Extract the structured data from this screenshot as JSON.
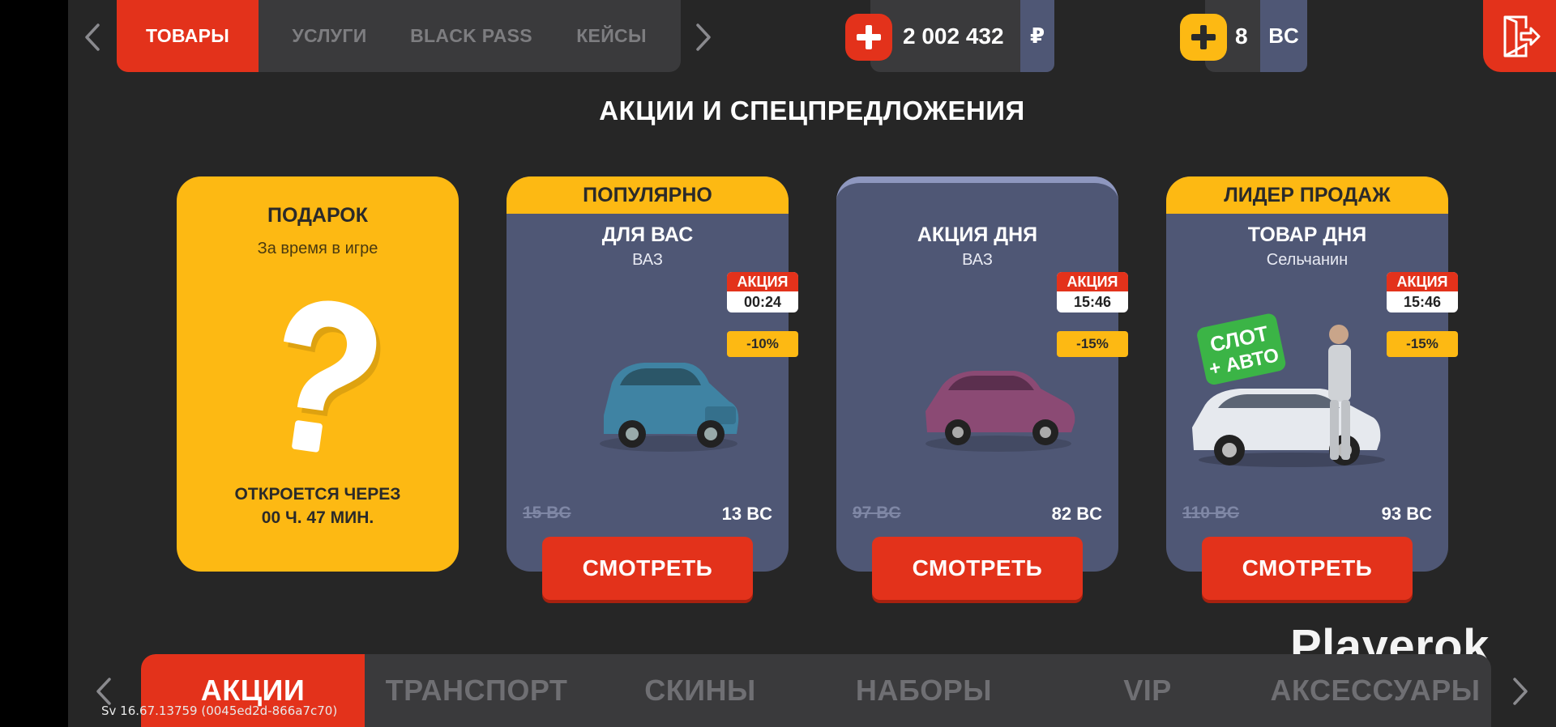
{
  "top_tabs": [
    "ТОВАРЫ",
    "УСЛУГИ",
    "BLACK PASS",
    "КЕЙСЫ"
  ],
  "currency_rub": {
    "value": "2 002 432",
    "unit": "₽"
  },
  "currency_bc": {
    "value": "8",
    "unit": "BC"
  },
  "section_title": "АКЦИИ И СПЕЦПРЕДЛОЖЕНИЯ",
  "gift": {
    "title": "ПОДАРОК",
    "subtitle": "За время в игре",
    "open_line1": "ОТКРОЕТСЯ ЧЕРЕЗ",
    "open_line2": "00 Ч. 47 МИН."
  },
  "offers": [
    {
      "band": "ПОПУЛЯРНО",
      "title": "ДЛЯ ВАС",
      "subtitle": "ВАЗ",
      "badge": "АКЦИЯ",
      "timer": "00:24",
      "discount": "-10%",
      "old_price": "15 BC",
      "new_price": "13 BC",
      "button": "СМОТРЕТЬ"
    },
    {
      "band": "",
      "title": "АКЦИЯ ДНЯ",
      "subtitle": "ВАЗ",
      "badge": "АКЦИЯ",
      "timer": "15:46",
      "discount": "-15%",
      "old_price": "97 BC",
      "new_price": "82 BC",
      "button": "СМОТРЕТЬ"
    },
    {
      "band": "ЛИДЕР ПРОДАЖ",
      "title": "ТОВАР ДНЯ",
      "subtitle": "Сельчанин",
      "badge": "АКЦИЯ",
      "timer": "15:46",
      "discount": "-15%",
      "old_price": "110 BC",
      "new_price": "93 BC",
      "button": "СМОТРЕТЬ",
      "sticker_line1": "СЛОТ",
      "sticker_line2": "+ АВТО"
    }
  ],
  "bottom_tabs": [
    "АКЦИИ",
    "ТРАНСПОРТ",
    "СКИНЫ",
    "НАБОРЫ",
    "VIP",
    "АКСЕССУАРЫ"
  ],
  "watermark": "Playerok",
  "version": "Sv 16.67.13759 (0045ed2d-866a7c70)",
  "colors": {
    "accent_red": "#e3321b",
    "accent_yellow": "#fdb913",
    "card_bg": "#4f5775",
    "panel_bg": "#262626"
  }
}
